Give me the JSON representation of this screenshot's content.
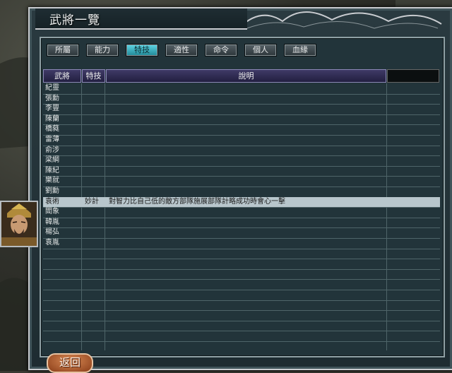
{
  "window": {
    "title": "武將一覽"
  },
  "tabs": [
    {
      "label": "所屬",
      "active": false
    },
    {
      "label": "能力",
      "active": false
    },
    {
      "label": "特技",
      "active": true
    },
    {
      "label": "適性",
      "active": false
    },
    {
      "label": "命令",
      "active": false
    },
    {
      "label": "個人",
      "active": false
    },
    {
      "label": "血緣",
      "active": false
    }
  ],
  "table": {
    "headers": {
      "name": "武將",
      "skill": "特技",
      "desc": "說明",
      "extra": ""
    },
    "rows": [
      {
        "name": "紀靈",
        "skill": "",
        "desc": ""
      },
      {
        "name": "張勳",
        "skill": "",
        "desc": ""
      },
      {
        "name": "李豐",
        "skill": "",
        "desc": ""
      },
      {
        "name": "陳蘭",
        "skill": "",
        "desc": ""
      },
      {
        "name": "橋蕤",
        "skill": "",
        "desc": ""
      },
      {
        "name": "雷薄",
        "skill": "",
        "desc": ""
      },
      {
        "name": "俞涉",
        "skill": "",
        "desc": ""
      },
      {
        "name": "梁綱",
        "skill": "",
        "desc": ""
      },
      {
        "name": "陳紀",
        "skill": "",
        "desc": ""
      },
      {
        "name": "樂就",
        "skill": "",
        "desc": ""
      },
      {
        "name": "劉勳",
        "skill": "",
        "desc": ""
      },
      {
        "name": "袁術",
        "skill": "妙計",
        "desc": "對智力比自己低的敵方部隊施展部隊計略成功時會心一擊",
        "selected": true
      },
      {
        "name": "閻象",
        "skill": "",
        "desc": ""
      },
      {
        "name": "韓胤",
        "skill": "",
        "desc": ""
      },
      {
        "name": "楊弘",
        "skill": "",
        "desc": ""
      },
      {
        "name": "袁胤",
        "skill": "",
        "desc": ""
      },
      {
        "name": "",
        "skill": "",
        "desc": ""
      },
      {
        "name": "",
        "skill": "",
        "desc": ""
      },
      {
        "name": "",
        "skill": "",
        "desc": ""
      },
      {
        "name": "",
        "skill": "",
        "desc": ""
      },
      {
        "name": "",
        "skill": "",
        "desc": ""
      },
      {
        "name": "",
        "skill": "",
        "desc": ""
      },
      {
        "name": "",
        "skill": "",
        "desc": ""
      },
      {
        "name": "",
        "skill": "",
        "desc": ""
      },
      {
        "name": "",
        "skill": "",
        "desc": ""
      }
    ]
  },
  "footer": {
    "back_label": "返回"
  },
  "colors": {
    "active_tab": "#3fb5c4",
    "selected_row": "#b8c6cc",
    "header_bg": "#2f2b55"
  }
}
